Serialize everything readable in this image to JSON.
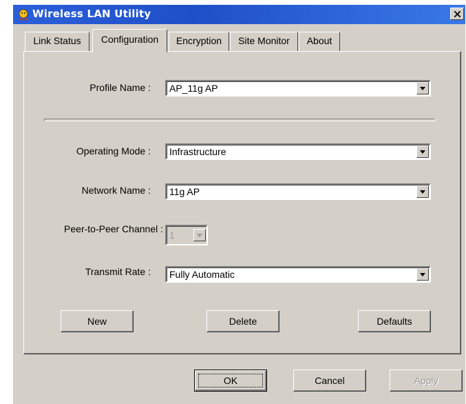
{
  "window": {
    "title": "Wireless LAN Utility"
  },
  "tabs": [
    {
      "label": "Link Status",
      "active": false
    },
    {
      "label": "Configuration",
      "active": true
    },
    {
      "label": "Encryption",
      "active": false
    },
    {
      "label": "Site Monitor",
      "active": false
    },
    {
      "label": "About",
      "active": false
    }
  ],
  "form": {
    "profile_name": {
      "label": "Profile Name :",
      "value": "AP_11g AP"
    },
    "operating_mode": {
      "label": "Operating Mode :",
      "value": "Infrastructure"
    },
    "network_name": {
      "label": "Network Name :",
      "value": "11g AP"
    },
    "peer_channel": {
      "label": "Peer-to-Peer Channel :",
      "value": "1"
    },
    "transmit_rate": {
      "label": "Transmit Rate :",
      "value": "Fully Automatic"
    }
  },
  "buttons": {
    "new": "New",
    "delete": "Delete",
    "defaults": "Defaults",
    "ok": "OK",
    "cancel": "Cancel",
    "apply": "Apply"
  },
  "colors": {
    "title_bar": "#2b5fd9",
    "dialog_face": "#d4d0c8"
  }
}
